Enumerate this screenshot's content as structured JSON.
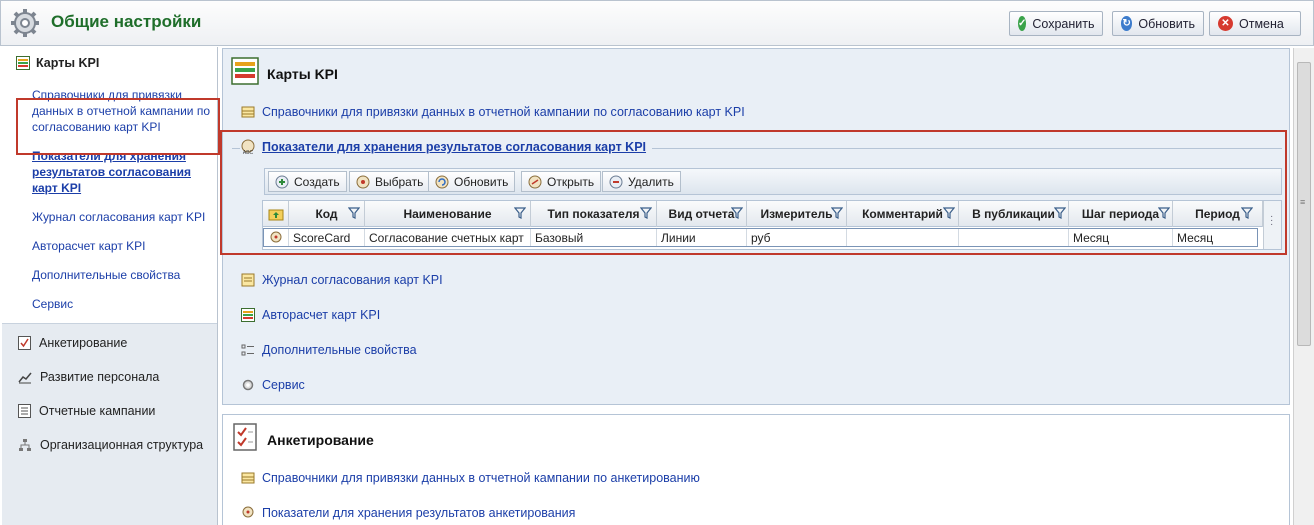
{
  "header": {
    "title": "Общие настройки",
    "save_label": "Сохранить",
    "refresh_label": "Обновить",
    "cancel_label": "Отмена"
  },
  "leftnav": {
    "active_section": "Карты KPI",
    "items": [
      {
        "label": "Справочники для привязки данных в отчетной кампании по согласованию карт KPI"
      },
      {
        "label": "Показатели для хранения результатов согласования карт KPI"
      },
      {
        "label": "Журнал согласования карт KPI"
      },
      {
        "label": "Авторасчет карт KPI"
      },
      {
        "label": "Дополнительные свойства"
      },
      {
        "label": "Сервис"
      }
    ],
    "sections": [
      {
        "label": "Анкетирование"
      },
      {
        "label": "Развитие персонала"
      },
      {
        "label": "Отчетные кампании"
      },
      {
        "label": "Организационная структура"
      }
    ]
  },
  "panel1": {
    "title": "Карты KPI",
    "link_dicts": "Справочники для привязки данных в отчетной кампании по согласованию карт KPI",
    "group_title": "Показатели для хранения результатов согласования карт KPI",
    "toolbar": {
      "create": "Создать",
      "select": "Выбрать",
      "refresh": "Обновить",
      "open": "Открыть",
      "delete": "Удалить"
    },
    "grid": {
      "columns": [
        "Код",
        "Наименование",
        "Тип показателя",
        "Вид отчета",
        "Измеритель",
        "Комментарий",
        "В публикации",
        "Шаг периода",
        "Период"
      ],
      "rows": [
        [
          "ScoreCard",
          "Согласование счетных карт",
          "Базовый",
          "Линии",
          "руб",
          "",
          "",
          "Месяц",
          "Месяц"
        ]
      ]
    },
    "link_journal": "Журнал согласования карт KPI",
    "link_autocalc": "Авторасчет карт KPI",
    "link_props": "Дополнительные свойства",
    "link_service": "Сервис"
  },
  "panel2": {
    "title": "Анкетирование",
    "link_dicts": "Справочники для привязки данных в отчетной кампании по анкетированию",
    "link_indicators": "Показатели для хранения результатов анкетирования"
  },
  "colors": {
    "link": "#1b3ea8",
    "title_green": "#1f6e2a",
    "highlight_red": "#c0392b",
    "panel_bg": "#e9eff6"
  }
}
